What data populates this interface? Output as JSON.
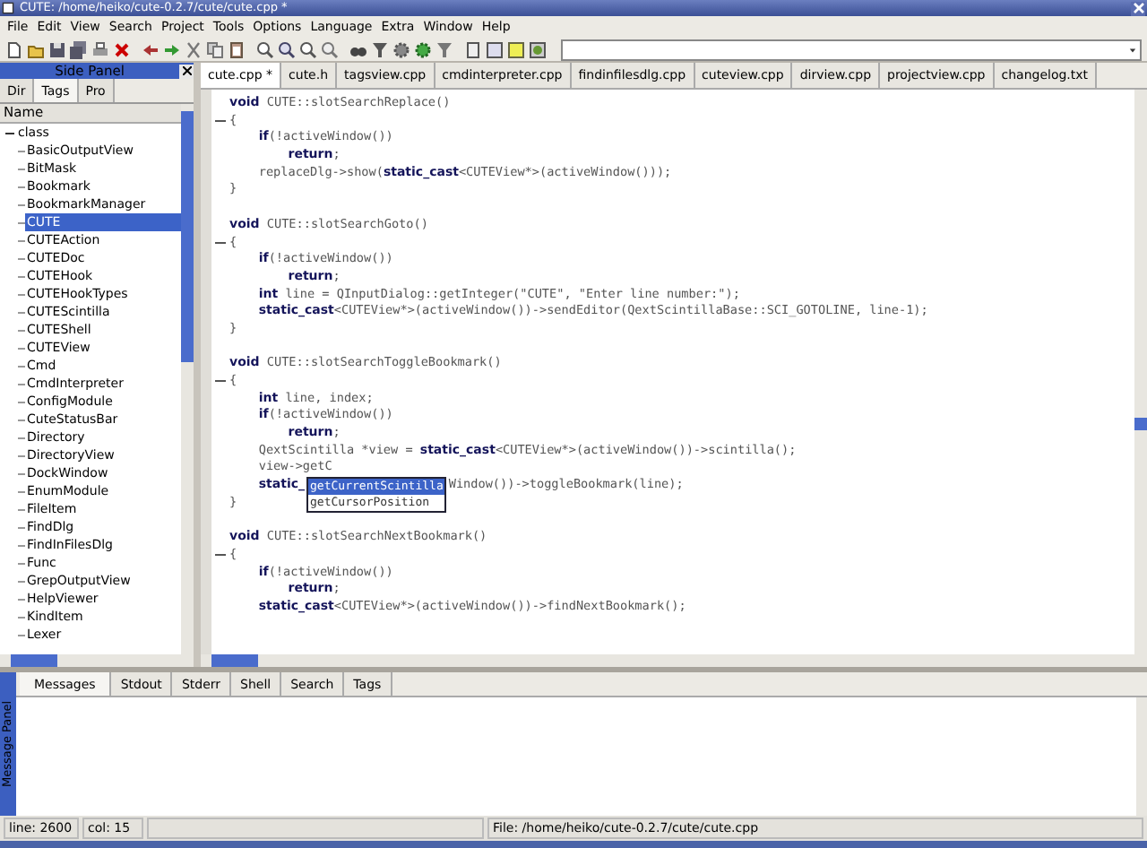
{
  "window": {
    "title": "CUTE: /home/heiko/cute-0.2.7/cute/cute.cpp *"
  },
  "menu": [
    "File",
    "Edit",
    "View",
    "Search",
    "Project",
    "Tools",
    "Options",
    "Language",
    "Extra",
    "Window",
    "Help"
  ],
  "side_panel": {
    "title": "Side Panel",
    "tabs": [
      {
        "label": "Dir",
        "selected": false
      },
      {
        "label": "Tags",
        "selected": true
      },
      {
        "label": "Pro",
        "selected": false
      }
    ],
    "column": "Name",
    "tree": [
      {
        "label": "class",
        "expanded": true,
        "selected": false,
        "children": [
          {
            "label": "BasicOutputView",
            "selected": false
          },
          {
            "label": "BitMask",
            "selected": false
          },
          {
            "label": "Bookmark",
            "selected": false
          },
          {
            "label": "BookmarkManager",
            "selected": false
          },
          {
            "label": "CUTE",
            "selected": true
          },
          {
            "label": "CUTEAction",
            "selected": false
          },
          {
            "label": "CUTEDoc",
            "selected": false
          },
          {
            "label": "CUTEHook",
            "selected": false
          },
          {
            "label": "CUTEHookTypes",
            "selected": false
          },
          {
            "label": "CUTEScintilla",
            "selected": false
          },
          {
            "label": "CUTEShell",
            "selected": false
          },
          {
            "label": "CUTEView",
            "selected": false
          },
          {
            "label": "Cmd",
            "selected": false
          },
          {
            "label": "CmdInterpreter",
            "selected": false
          },
          {
            "label": "ConfigModule",
            "selected": false
          },
          {
            "label": "CuteStatusBar",
            "selected": false
          },
          {
            "label": "Directory",
            "selected": false
          },
          {
            "label": "DirectoryView",
            "selected": false
          },
          {
            "label": "DockWindow",
            "selected": false
          },
          {
            "label": "EnumModule",
            "selected": false
          },
          {
            "label": "FileItem",
            "selected": false
          },
          {
            "label": "FindDlg",
            "selected": false
          },
          {
            "label": "FindInFilesDlg",
            "selected": false
          },
          {
            "label": "Func",
            "selected": false
          },
          {
            "label": "GrepOutputView",
            "selected": false
          },
          {
            "label": "HelpViewer",
            "selected": false
          },
          {
            "label": "KindItem",
            "selected": false
          },
          {
            "label": "Lexer",
            "selected": false
          }
        ]
      }
    ]
  },
  "editor_tabs": [
    {
      "label": "cute.cpp *",
      "selected": true
    },
    {
      "label": "cute.h",
      "selected": false
    },
    {
      "label": "tagsview.cpp",
      "selected": false
    },
    {
      "label": "cmdinterpreter.cpp",
      "selected": false
    },
    {
      "label": "findinfilesdlg.cpp",
      "selected": false
    },
    {
      "label": "cuteview.cpp",
      "selected": false
    },
    {
      "label": "dirview.cpp",
      "selected": false
    },
    {
      "label": "projectview.cpp",
      "selected": false
    },
    {
      "label": "changelog.txt",
      "selected": false
    }
  ],
  "code": [
    {
      "lines": [
        {
          "text": "**void** CUTE::slotSearchReplace()"
        },
        {
          "text": "{",
          "fold": true
        },
        {
          "text": "    **if**(!activeWindow())"
        },
        {
          "text": "        **return**;"
        },
        {
          "text": "    replaceDlg->show(**static_cast**<CUTEView*>(activeWindow()));"
        },
        {
          "text": "}"
        }
      ]
    },
    {
      "lines": [
        {
          "text": "**void** CUTE::slotSearchGoto()"
        },
        {
          "text": "{",
          "fold": true
        },
        {
          "text": "    **if**(!activeWindow())"
        },
        {
          "text": "        **return**;"
        },
        {
          "text": "    **int** line = QInputDialog::getInteger(\"CUTE\", \"Enter line number:\");"
        },
        {
          "text": "    **static_cast**<CUTEView*>(activeWindow())->sendEditor(QextScintillaBase::SCI_GOTOLINE, line-1);"
        },
        {
          "text": "}"
        }
      ]
    },
    {
      "lines": [
        {
          "text": "**void** CUTE::slotSearchToggleBookmark()"
        },
        {
          "text": "{",
          "fold": true
        },
        {
          "text": "    **int** line, index;"
        },
        {
          "text": "    **if**(!activeWindow())"
        },
        {
          "text": "        **return**;"
        },
        {
          "text": "    QextScintilla *view = **static_cast**<CUTEView*>(activeWindow())->scintilla();"
        },
        {
          "text": "    view->getC"
        },
        {
          "text": "    **static_**",
          "tail": "Window())->toggleBookmark(line);"
        },
        {
          "text": "}"
        }
      ]
    },
    {
      "lines": [
        {
          "text": "**void** CUTE::slotSearchNextBookmark()"
        },
        {
          "text": "{",
          "fold": true
        },
        {
          "text": "    **if**(!activeWindow())"
        },
        {
          "text": "        **return**;"
        },
        {
          "text": "    **static_cast**<CUTEView*>(activeWindow())->findNextBookmark();"
        }
      ]
    }
  ],
  "autocomplete": [
    {
      "label": "getCurrentScintilla",
      "selected": true
    },
    {
      "label": "getCursorPosition",
      "selected": false
    }
  ],
  "message_panel": {
    "title": "Message Panel",
    "tabs": [
      {
        "label": "Messages",
        "selected": true
      },
      {
        "label": "Stdout",
        "selected": false
      },
      {
        "label": "Stderr",
        "selected": false
      },
      {
        "label": "Shell",
        "selected": false
      },
      {
        "label": "Search",
        "selected": false
      },
      {
        "label": "Tags",
        "selected": false
      }
    ]
  },
  "status_bar": {
    "line": "line: 2600",
    "col": "col: 15",
    "file": "File: /home/heiko/cute-0.2.7/cute/cute.cpp"
  }
}
